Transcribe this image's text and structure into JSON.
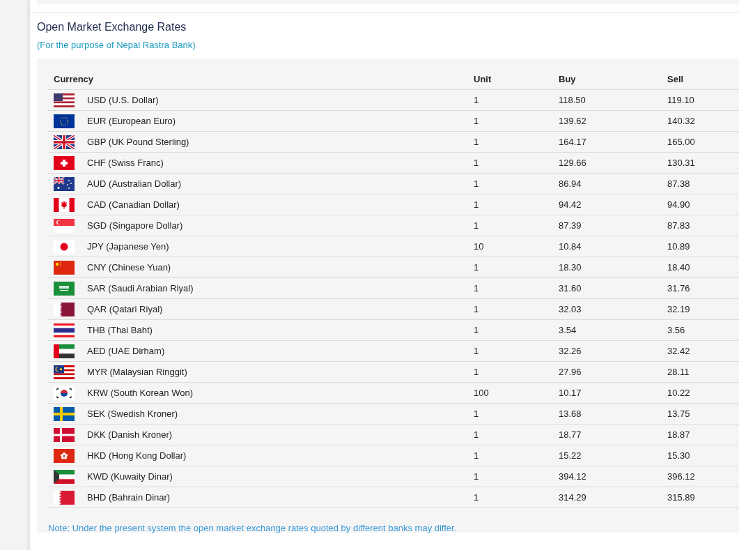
{
  "title": "Open Market Exchange Rates",
  "subtitle": "(For the purpose of Nepal Rastra Bank)",
  "table": {
    "columns": [
      "Currency",
      "Unit",
      "Buy",
      "Sell"
    ],
    "rows": [
      {
        "kind": "us",
        "currency": "USD (U.S. Dollar)",
        "unit": "1",
        "buy": "118.50",
        "sell": "119.10"
      },
      {
        "kind": "eu",
        "currency": "EUR (European Euro)",
        "unit": "1",
        "buy": "139.62",
        "sell": "140.32"
      },
      {
        "kind": "gb",
        "currency": "GBP (UK Pound Sterling)",
        "unit": "1",
        "buy": "164.17",
        "sell": "165.00"
      },
      {
        "kind": "ch",
        "currency": "CHF (Swiss Franc)",
        "unit": "1",
        "buy": "129.66",
        "sell": "130.31"
      },
      {
        "kind": "au",
        "currency": "AUD (Australian Dollar)",
        "unit": "1",
        "buy": "86.94",
        "sell": "87.38"
      },
      {
        "kind": "ca",
        "currency": "CAD (Canadian Dollar)",
        "unit": "1",
        "buy": "94.42",
        "sell": "94.90"
      },
      {
        "kind": "sg",
        "currency": "SGD (Singapore Dollar)",
        "unit": "1",
        "buy": "87.39",
        "sell": "87.83"
      },
      {
        "kind": "jp",
        "currency": "JPY (Japanese Yen)",
        "unit": "10",
        "buy": "10.84",
        "sell": "10.89"
      },
      {
        "kind": "cn",
        "currency": "CNY (Chinese Yuan)",
        "unit": "1",
        "buy": "18.30",
        "sell": "18.40"
      },
      {
        "kind": "sa",
        "currency": "SAR (Saudi Arabian Riyal)",
        "unit": "1",
        "buy": "31.60",
        "sell": "31.76"
      },
      {
        "kind": "qa",
        "currency": "QAR (Qatari Riyal)",
        "unit": "1",
        "buy": "32.03",
        "sell": "32.19"
      },
      {
        "kind": "th",
        "currency": "THB (Thai Baht)",
        "unit": "1",
        "buy": "3.54",
        "sell": "3.56"
      },
      {
        "kind": "ae",
        "currency": "AED (UAE Dirham)",
        "unit": "1",
        "buy": "32.26",
        "sell": "32.42"
      },
      {
        "kind": "my",
        "currency": "MYR (Malaysian Ringgit)",
        "unit": "1",
        "buy": "27.96",
        "sell": "28.11"
      },
      {
        "kind": "kr",
        "currency": "KRW (South Korean Won)",
        "unit": "100",
        "buy": "10.17",
        "sell": "10.22"
      },
      {
        "kind": "se",
        "currency": "SEK (Swedish Kroner)",
        "unit": "1",
        "buy": "13.68",
        "sell": "13.75"
      },
      {
        "kind": "dk",
        "currency": "DKK (Danish Kroner)",
        "unit": "1",
        "buy": "18.77",
        "sell": "18.87"
      },
      {
        "kind": "hk",
        "currency": "HKD (Hong Kong Dollar)",
        "unit": "1",
        "buy": "15.22",
        "sell": "15.30"
      },
      {
        "kind": "kw",
        "currency": "KWD (Kuwaity Dinar)",
        "unit": "1",
        "buy": "394.12",
        "sell": "396.12"
      },
      {
        "kind": "bh",
        "currency": "BHD (Bahrain Dinar)",
        "unit": "1",
        "buy": "314.29",
        "sell": "315.89"
      }
    ]
  },
  "note": "Note: Under the present system the open market exchange rates quoted by different banks may differ."
}
